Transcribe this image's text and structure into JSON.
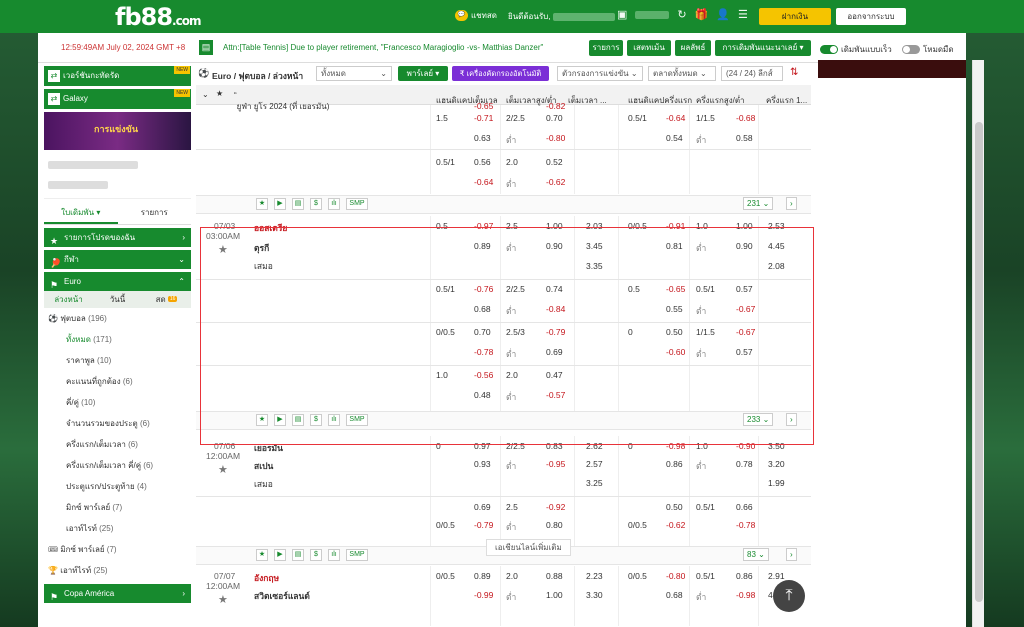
{
  "header": {
    "logo_main": "fb88",
    "logo_suffix": ".com",
    "chat_label": "แชทสด",
    "welcome_label": "ยินดีต้อนรับ,",
    "deposit_label": "ฝากเงิน",
    "logout_label": "ออกจากระบบ"
  },
  "infobar": {
    "time": "12:59:49AM July 02, 2024 GMT +8",
    "ticker": "Attn:[Table Tennis] Due to player retirement, \"Francesco Maragioglio -vs- Matthias Danzer\"",
    "btn_list": "รายการ",
    "btn_statement": "เสตทเม้น",
    "btn_results": "ผลลัพธ์",
    "btn_bet_settings": "การเดิมพันแนะนาเลย์",
    "toggle_quick": "เดิมพันแบบเร็ว",
    "toggle_night": "โหมดมืด"
  },
  "sidebar": {
    "banner1": "เวอร์ชันกะทัดรัด",
    "banner2": "Galaxy",
    "new_badge": "NEW",
    "promo_text": "การแข่งขัน",
    "tabs": [
      "ใบเดิมพัน",
      "รายการ"
    ],
    "head_promos": "รายการโปรดของฉัน",
    "head_sports": "กีฬา",
    "head_euro": "Euro",
    "subtabs": [
      "ล่วงหน้า",
      "วันนี้",
      "สด"
    ],
    "live_badge": "16",
    "football": "ฟุตบอล",
    "football_count": "(196)",
    "items": [
      {
        "label": "ทั้งหมด",
        "count": "(171)"
      },
      {
        "label": "ราคาพูล",
        "count": "(10)"
      },
      {
        "label": "คะแนนที่ถูกต้อง",
        "count": "(6)"
      },
      {
        "label": "คี่/คู่",
        "count": "(10)"
      },
      {
        "label": "จำนวนรวมของประตู",
        "count": "(6)"
      },
      {
        "label": "ครึ่งแรก/เต็มเวลา",
        "count": "(6)"
      },
      {
        "label": "ครึ่งแรก/เต็มเวลา คี่/คู่",
        "count": "(6)"
      },
      {
        "label": "ประตูแรก/ประตูท้าย",
        "count": "(4)"
      },
      {
        "label": "มิกซ์ พาร์เลย์",
        "count": "(7)"
      },
      {
        "label": "เอาท์ไรท์",
        "count": "(25)"
      }
    ],
    "mix_parlay": "มิกซ์ พาร์เลย์",
    "mix_parlay_count": "(7)",
    "outright": "เอาท์ไรท์",
    "outright_count": "(25)",
    "copa": "Copa América"
  },
  "filterbar": {
    "title": "Euro / ฟุตบอล / ล่วงหน้า",
    "select_all": "ทั้งหมด",
    "parlay": "พาร์เลย์",
    "filter_tool": "₹ เครื่องคัดกรองอัตโนมัติ",
    "sort_select": "ตัวกรองการแข่งขัน",
    "market_select": "ตลาดทั้งหมด",
    "league_count": "(24 / 24) ลีกส์"
  },
  "columns": {
    "league": "ยูฟ่า ยูโร 2024 (ที่ เยอรมัน)",
    "h1": "แฮนดิแคปเต็มเวล",
    "h2": "เต็มเวลาสูง/ต่ำ",
    "h3": "เต็มเวลา ...",
    "h4": "แฮนดิแคปครึ่งแรก",
    "h5": "ครึ่งแรกสูง/ต่ำ",
    "h6": "ครึ่งแรก 1..."
  },
  "low_label": "ต่ำ",
  "more_label": "เอเชียนไลน์เพิ่มเติม",
  "match0": {
    "lines": [
      [
        "1.5",
        "-0.71",
        "2/2.5",
        "0.70",
        "",
        "0.5/1",
        "-0.64",
        "1/1.5",
        "-0.68",
        ""
      ],
      [
        "",
        "0.63",
        "",
        "-0.80",
        "",
        "",
        "0.54",
        "",
        "0.58",
        ""
      ],
      [
        "0.5/1",
        "0.56",
        "2.0",
        "0.52",
        "",
        "",
        "",
        "",
        "",
        ""
      ],
      [
        "",
        "-0.64",
        "",
        "-0.62",
        "",
        "",
        "",
        "",
        "",
        ""
      ]
    ],
    "pager": "231"
  },
  "match1": {
    "date": "07/03",
    "time": "03:00AM",
    "home": "ออสเตรีย",
    "away": "ตุรกี",
    "draw": "เสมอ",
    "pager": "233",
    "rows": [
      [
        "0.5",
        "-0.97",
        "2.5",
        "1.00",
        "2.03",
        "0/0.5",
        "-0.91",
        "1.0",
        "1.00",
        "2.53"
      ],
      [
        "",
        "0.89",
        "",
        "0.90",
        "3.45",
        "",
        "0.81",
        "",
        "0.90",
        "4.45"
      ],
      [
        "",
        "",
        "",
        "",
        "3.35",
        "",
        "",
        "",
        "",
        "2.08"
      ],
      [
        "0.5/1",
        "-0.76",
        "2/2.5",
        "0.74",
        "",
        "0.5",
        "-0.65",
        "0.5/1",
        "0.57",
        ""
      ],
      [
        "",
        "0.68",
        "",
        "-0.84",
        "",
        "",
        "0.55",
        "",
        "-0.67",
        ""
      ],
      [
        "0/0.5",
        "0.70",
        "2.5/3",
        "-0.79",
        "",
        "0",
        "0.50",
        "1/1.5",
        "-0.67",
        ""
      ],
      [
        "",
        "-0.78",
        "",
        "0.69",
        "",
        "",
        "-0.60",
        "",
        "0.57",
        ""
      ],
      [
        "1.0",
        "-0.56",
        "2.0",
        "0.47",
        "",
        "",
        "",
        "",
        "",
        ""
      ],
      [
        "",
        "0.48",
        "",
        "-0.57",
        "",
        "",
        "",
        "",
        "",
        ""
      ]
    ]
  },
  "match2": {
    "date": "07/06",
    "time": "12:00AM",
    "home": "เยอรมัน",
    "away": "สเปน",
    "draw": "เสมอ",
    "pager": "83",
    "rows": [
      [
        "0",
        "0.97",
        "2/2.5",
        "0.83",
        "2.62",
        "0",
        "-0.98",
        "1.0",
        "-0.90",
        "3.50"
      ],
      [
        "",
        "0.93",
        "",
        "-0.95",
        "2.57",
        "",
        "0.86",
        "",
        "0.78",
        "3.20"
      ],
      [
        "",
        "",
        "",
        "",
        "3.25",
        "",
        "",
        "",
        "",
        "1.99"
      ],
      [
        "",
        "0.69",
        "2.5",
        "-0.92",
        "",
        "",
        "0.50",
        "0.5/1",
        "0.66",
        ""
      ],
      [
        "0/0.5",
        "-0.79",
        "",
        "0.80",
        "",
        "0/0.5",
        "-0.62",
        "",
        "-0.78",
        ""
      ]
    ]
  },
  "match3": {
    "date": "07/07",
    "time": "12:00AM",
    "home": "อังกฤษ",
    "away": "สวิตเซอร์แลนด์",
    "rows": [
      [
        "0/0.5",
        "0.89",
        "2.0",
        "0.88",
        "2.23",
        "0/0.5",
        "-0.80",
        "0.5/1",
        "0.86",
        "2.91"
      ],
      [
        "",
        "-0.99",
        "",
        "1.00",
        "3.30",
        "",
        "0.68",
        "",
        "-0.98",
        "4.51"
      ]
    ]
  },
  "tools": [
    "★",
    "▶",
    "▤",
    "$",
    "ılı",
    "SMP"
  ]
}
